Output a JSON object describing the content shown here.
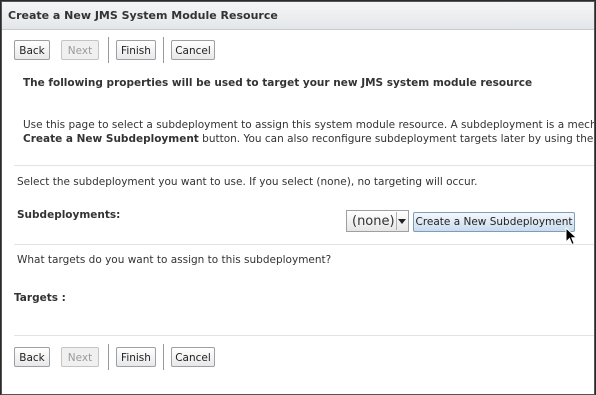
{
  "window": {
    "title": "Create a New JMS System Module Resource"
  },
  "buttons": {
    "back": "Back",
    "next": "Next",
    "finish": "Finish",
    "cancel": "Cancel"
  },
  "content": {
    "heading": "The following properties will be used to target your new JMS system module resource",
    "desc_line1": "Use this page to select a subdeployment to assign this system module resource. A subdeployment is a mechanism by",
    "desc_line2_bold": "Create a New Subdeployment",
    "desc_line2_rest": " button. You can also reconfigure subdeployment targets later by using the parent moo",
    "select_prompt": "Select the subdeployment you want to use. If you select (none), no targeting will occur.",
    "subdeployments_label": "Subdeployments:",
    "subdeployment_value": "(none)",
    "new_subdeployment_button": "Create a New Subdeployment",
    "targets_prompt": "What targets do you want to assign to this subdeployment?",
    "targets_label": "Targets :"
  },
  "icons": {
    "cursor": "mouse-pointer-icon",
    "dropdown": "chevron-down-icon"
  }
}
